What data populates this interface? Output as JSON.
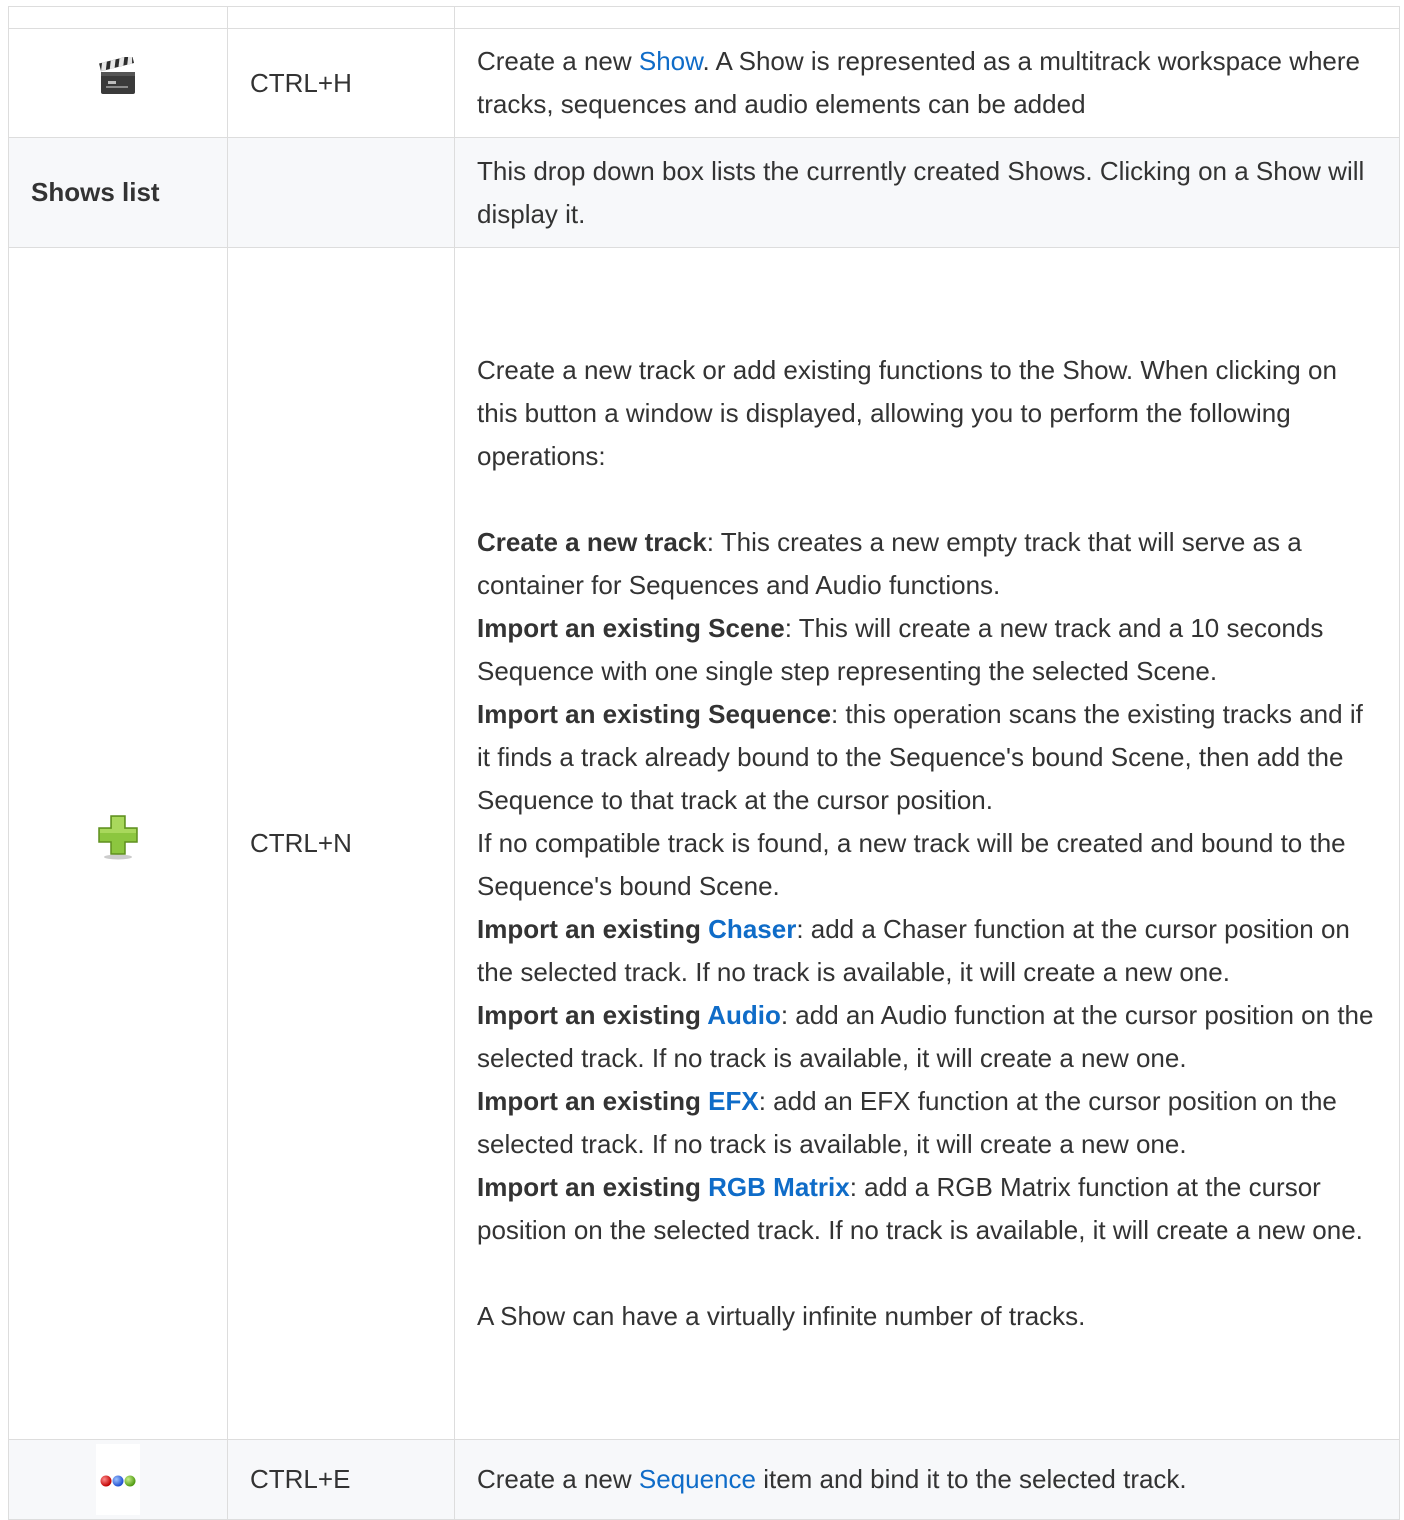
{
  "rows": [
    {
      "icon": "clapperboard-icon",
      "shortcut": "CTRL+H",
      "desc_before": "Create a new ",
      "desc_link": "Show",
      "desc_after": ". A Show is represented as a multitrack workspace where tracks, sequences and audio elements can be added"
    },
    {
      "name": "Shows list",
      "shortcut": "",
      "desc": "This drop down box lists the currently created Shows. Clicking on a Show will display it."
    },
    {
      "icon": "green-plus-icon",
      "shortcut": "CTRL+N",
      "intro": "Create a new track or add existing functions to the Show. When clicking on this button a window is displayed, allowing you to perform the following operations:",
      "ops": {
        "new_track": {
          "label": "Create a new track",
          "text": ": This creates a new empty track that will serve as a container for Sequences and Audio functions."
        },
        "scene": {
          "label": "Import an existing Scene",
          "text": ": This will create a new track and a 10 seconds Sequence with one single step representing the selected Scene."
        },
        "sequence": {
          "label": "Import an existing Sequence",
          "text": ": this operation scans the existing tracks and if it finds a track already bound to the Sequence's bound Scene, then add the Sequence to that track at the cursor position."
        },
        "sequence_note": "If no compatible track is found, a new track will be created and bound to the Sequence's bound Scene.",
        "chaser": {
          "label": "Import an existing ",
          "link": "Chaser",
          "text": ": add a Chaser function at the cursor position on the selected track. If no track is available, it will create a new one."
        },
        "audio": {
          "label": "Import an existing ",
          "link": "Audio",
          "text": ": add an Audio function at the cursor position on the selected track. If no track is available, it will create a new one."
        },
        "efx": {
          "label": "Import an existing ",
          "link": "EFX",
          "text": ": add an EFX function at the cursor position on the selected track. If no track is available, it will create a new one."
        },
        "rgb": {
          "label": "Import an existing ",
          "link": "RGB Matrix",
          "text": ": add a RGB Matrix function at the cursor position on the selected track. If no track is available, it will create a new one."
        }
      },
      "outro": "A Show can have a virtually infinite number of tracks."
    },
    {
      "icon": "three-dots-sequence-icon",
      "shortcut": "CTRL+E",
      "desc_before": "Create a new ",
      "desc_link": "Sequence",
      "desc_after": " item and bind it to the selected track."
    }
  ],
  "colors": {
    "link": "#0f6cc8",
    "text": "#333333",
    "border": "#dddddd",
    "stripe": "#f7f8fa"
  }
}
